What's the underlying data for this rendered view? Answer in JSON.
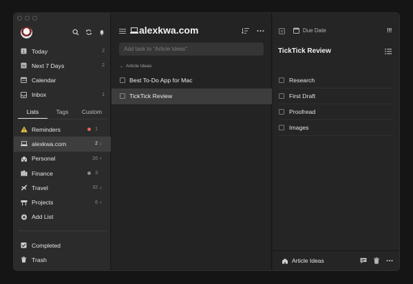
{
  "colors": {
    "accent_red": "#e8655a",
    "dot_gray": "#8c8c8c",
    "warning_yellow": "#f2c94c"
  },
  "sidebar": {
    "top_icons": [
      "search-icon",
      "sync-icon",
      "bell-icon"
    ],
    "smart_lists": [
      {
        "label": "Today",
        "count": "2",
        "icon": "calendar-day-icon"
      },
      {
        "label": "Next 7 Days",
        "count": "2",
        "icon": "calendar-week-icon"
      },
      {
        "label": "Calendar",
        "count": "",
        "icon": "calendar-icon"
      },
      {
        "label": "Inbox",
        "count": "1",
        "icon": "inbox-icon"
      }
    ],
    "tabs": [
      {
        "label": "Lists",
        "active": true
      },
      {
        "label": "Tags",
        "active": false
      },
      {
        "label": "Custom",
        "active": false
      }
    ],
    "lists": [
      {
        "label": "Reminders",
        "count": "1",
        "dot": "#e8655a",
        "icon": "warning-icon",
        "chevron": false
      },
      {
        "label": "alexkwa.com",
        "count": "2",
        "dot": "",
        "icon": "computer-icon",
        "chevron": true,
        "selected": true
      },
      {
        "label": "Personal",
        "count": "26",
        "dot": "",
        "icon": "house-icon",
        "chevron": true
      },
      {
        "label": "Finance",
        "count": "3",
        "dot": "#8c8c8c",
        "icon": "building-icon",
        "chevron": false
      },
      {
        "label": "Travel",
        "count": "32",
        "dot": "",
        "icon": "airplane-icon",
        "chevron": true
      },
      {
        "label": "Projects",
        "count": "6",
        "dot": "",
        "icon": "project-icon",
        "chevron": true
      },
      {
        "label": "Add List",
        "count": "",
        "dot": "",
        "icon": "plus-circle-icon",
        "chevron": false
      }
    ],
    "bottom": [
      {
        "label": "Completed",
        "icon": "checkbox-checked-icon"
      },
      {
        "label": "Trash",
        "icon": "trash-icon"
      }
    ]
  },
  "middle": {
    "title": "alexkwa.com",
    "add_task_placeholder": "Add task to \"Article Ideas\"",
    "section": "Article Ideas",
    "tasks": [
      {
        "label": "Best To-Do App for Mac",
        "selected": false
      },
      {
        "label": "TickTick Review",
        "selected": true
      }
    ]
  },
  "detail": {
    "due_label": "Due Date",
    "priority": "!!!",
    "title": "TickTick Review",
    "subtasks": [
      "Research",
      "First Draft",
      "Proofread",
      "Images"
    ],
    "footer_list": "Article Ideas"
  }
}
